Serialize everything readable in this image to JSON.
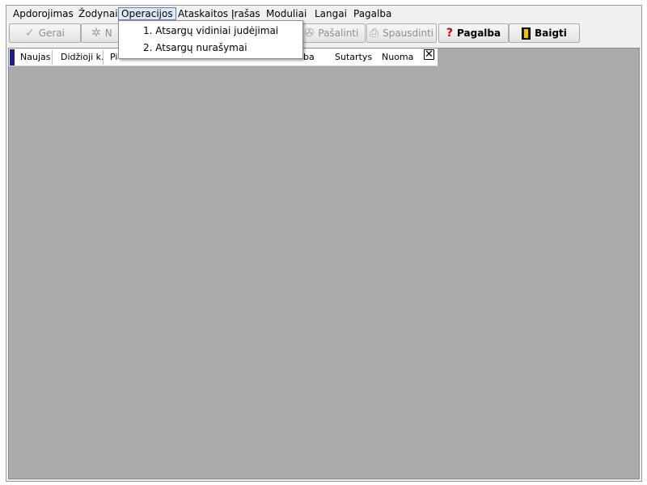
{
  "menubar": {
    "items": [
      {
        "label": "Apdorojimas",
        "name": "menu-apdorojimas"
      },
      {
        "label": "Žodynai",
        "name": "menu-zodynai"
      },
      {
        "label": "Operacijos",
        "name": "menu-operacijos"
      },
      {
        "label": "Ataskaitos",
        "name": "menu-ataskaitos"
      },
      {
        "label": "Įrašas",
        "name": "menu-irasas"
      },
      {
        "label": "Moduliai",
        "name": "menu-moduliai"
      },
      {
        "label": "Langai",
        "name": "menu-langai"
      },
      {
        "label": "Pagalba",
        "name": "menu-pagalba"
      }
    ]
  },
  "toolbar": {
    "gerai": "Gerai",
    "naujas_partial": "N",
    "pasalinti": "Pašalinti",
    "spausdinti": "Spausdinti",
    "pagalba": "Pagalba",
    "baigti": "Baigti"
  },
  "strip": {
    "items": [
      "Naujas",
      "Didžioji k.",
      "Pi",
      "ba",
      "Sutartys",
      "Nuoma"
    ],
    "close": "✕"
  },
  "dropdown": {
    "items": [
      "1. Atsargų vidiniai judėjimai",
      "2. Atsargų nurašymai"
    ]
  },
  "icons": {
    "gerai": "checkmark-icon",
    "naujas": "star-icon",
    "pasalinti": "delete-icon",
    "spausdinti": "printer-icon",
    "pagalba": "help-icon",
    "baigti": "exit-door-icon"
  },
  "colors": {
    "workspace": "#ababab",
    "strip_marker": "#1e1e8a",
    "help_icon": "#d40000"
  }
}
